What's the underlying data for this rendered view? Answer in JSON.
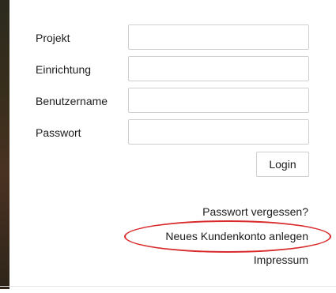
{
  "form": {
    "fields": [
      {
        "label": "Projekt",
        "value": "",
        "placeholder": ""
      },
      {
        "label": "Einrichtung",
        "value": "",
        "placeholder": ""
      },
      {
        "label": "Benutzername",
        "value": "",
        "placeholder": ""
      },
      {
        "label": "Passwort",
        "value": "",
        "placeholder": ""
      }
    ],
    "login_label": "Login"
  },
  "links": {
    "forgot_password": "Passwort vergessen?",
    "new_account": "Neues Kundenkonto anlegen",
    "imprint": "Impressum"
  },
  "colors": {
    "annotation": "#d92b2b"
  }
}
